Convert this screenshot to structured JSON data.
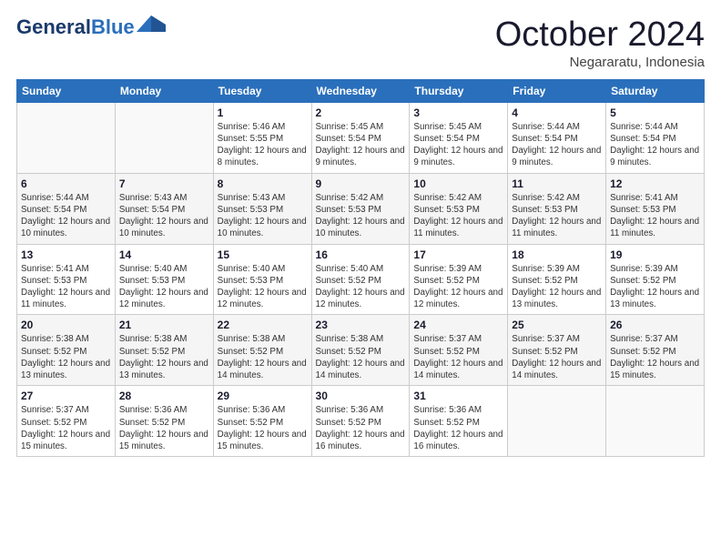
{
  "header": {
    "logo_line1": "General",
    "logo_line2": "Blue",
    "month": "October 2024",
    "location": "Negararatu, Indonesia"
  },
  "weekdays": [
    "Sunday",
    "Monday",
    "Tuesday",
    "Wednesday",
    "Thursday",
    "Friday",
    "Saturday"
  ],
  "weeks": [
    [
      {
        "day": "",
        "info": ""
      },
      {
        "day": "",
        "info": ""
      },
      {
        "day": "1",
        "info": "Sunrise: 5:46 AM\nSunset: 5:55 PM\nDaylight: 12 hours and 8 minutes."
      },
      {
        "day": "2",
        "info": "Sunrise: 5:45 AM\nSunset: 5:54 PM\nDaylight: 12 hours and 9 minutes."
      },
      {
        "day": "3",
        "info": "Sunrise: 5:45 AM\nSunset: 5:54 PM\nDaylight: 12 hours and 9 minutes."
      },
      {
        "day": "4",
        "info": "Sunrise: 5:44 AM\nSunset: 5:54 PM\nDaylight: 12 hours and 9 minutes."
      },
      {
        "day": "5",
        "info": "Sunrise: 5:44 AM\nSunset: 5:54 PM\nDaylight: 12 hours and 9 minutes."
      }
    ],
    [
      {
        "day": "6",
        "info": "Sunrise: 5:44 AM\nSunset: 5:54 PM\nDaylight: 12 hours and 10 minutes."
      },
      {
        "day": "7",
        "info": "Sunrise: 5:43 AM\nSunset: 5:54 PM\nDaylight: 12 hours and 10 minutes."
      },
      {
        "day": "8",
        "info": "Sunrise: 5:43 AM\nSunset: 5:53 PM\nDaylight: 12 hours and 10 minutes."
      },
      {
        "day": "9",
        "info": "Sunrise: 5:42 AM\nSunset: 5:53 PM\nDaylight: 12 hours and 10 minutes."
      },
      {
        "day": "10",
        "info": "Sunrise: 5:42 AM\nSunset: 5:53 PM\nDaylight: 12 hours and 11 minutes."
      },
      {
        "day": "11",
        "info": "Sunrise: 5:42 AM\nSunset: 5:53 PM\nDaylight: 12 hours and 11 minutes."
      },
      {
        "day": "12",
        "info": "Sunrise: 5:41 AM\nSunset: 5:53 PM\nDaylight: 12 hours and 11 minutes."
      }
    ],
    [
      {
        "day": "13",
        "info": "Sunrise: 5:41 AM\nSunset: 5:53 PM\nDaylight: 12 hours and 11 minutes."
      },
      {
        "day": "14",
        "info": "Sunrise: 5:40 AM\nSunset: 5:53 PM\nDaylight: 12 hours and 12 minutes."
      },
      {
        "day": "15",
        "info": "Sunrise: 5:40 AM\nSunset: 5:53 PM\nDaylight: 12 hours and 12 minutes."
      },
      {
        "day": "16",
        "info": "Sunrise: 5:40 AM\nSunset: 5:52 PM\nDaylight: 12 hours and 12 minutes."
      },
      {
        "day": "17",
        "info": "Sunrise: 5:39 AM\nSunset: 5:52 PM\nDaylight: 12 hours and 12 minutes."
      },
      {
        "day": "18",
        "info": "Sunrise: 5:39 AM\nSunset: 5:52 PM\nDaylight: 12 hours and 13 minutes."
      },
      {
        "day": "19",
        "info": "Sunrise: 5:39 AM\nSunset: 5:52 PM\nDaylight: 12 hours and 13 minutes."
      }
    ],
    [
      {
        "day": "20",
        "info": "Sunrise: 5:38 AM\nSunset: 5:52 PM\nDaylight: 12 hours and 13 minutes."
      },
      {
        "day": "21",
        "info": "Sunrise: 5:38 AM\nSunset: 5:52 PM\nDaylight: 12 hours and 13 minutes."
      },
      {
        "day": "22",
        "info": "Sunrise: 5:38 AM\nSunset: 5:52 PM\nDaylight: 12 hours and 14 minutes."
      },
      {
        "day": "23",
        "info": "Sunrise: 5:38 AM\nSunset: 5:52 PM\nDaylight: 12 hours and 14 minutes."
      },
      {
        "day": "24",
        "info": "Sunrise: 5:37 AM\nSunset: 5:52 PM\nDaylight: 12 hours and 14 minutes."
      },
      {
        "day": "25",
        "info": "Sunrise: 5:37 AM\nSunset: 5:52 PM\nDaylight: 12 hours and 14 minutes."
      },
      {
        "day": "26",
        "info": "Sunrise: 5:37 AM\nSunset: 5:52 PM\nDaylight: 12 hours and 15 minutes."
      }
    ],
    [
      {
        "day": "27",
        "info": "Sunrise: 5:37 AM\nSunset: 5:52 PM\nDaylight: 12 hours and 15 minutes."
      },
      {
        "day": "28",
        "info": "Sunrise: 5:36 AM\nSunset: 5:52 PM\nDaylight: 12 hours and 15 minutes."
      },
      {
        "day": "29",
        "info": "Sunrise: 5:36 AM\nSunset: 5:52 PM\nDaylight: 12 hours and 15 minutes."
      },
      {
        "day": "30",
        "info": "Sunrise: 5:36 AM\nSunset: 5:52 PM\nDaylight: 12 hours and 16 minutes."
      },
      {
        "day": "31",
        "info": "Sunrise: 5:36 AM\nSunset: 5:52 PM\nDaylight: 12 hours and 16 minutes."
      },
      {
        "day": "",
        "info": ""
      },
      {
        "day": "",
        "info": ""
      }
    ]
  ]
}
